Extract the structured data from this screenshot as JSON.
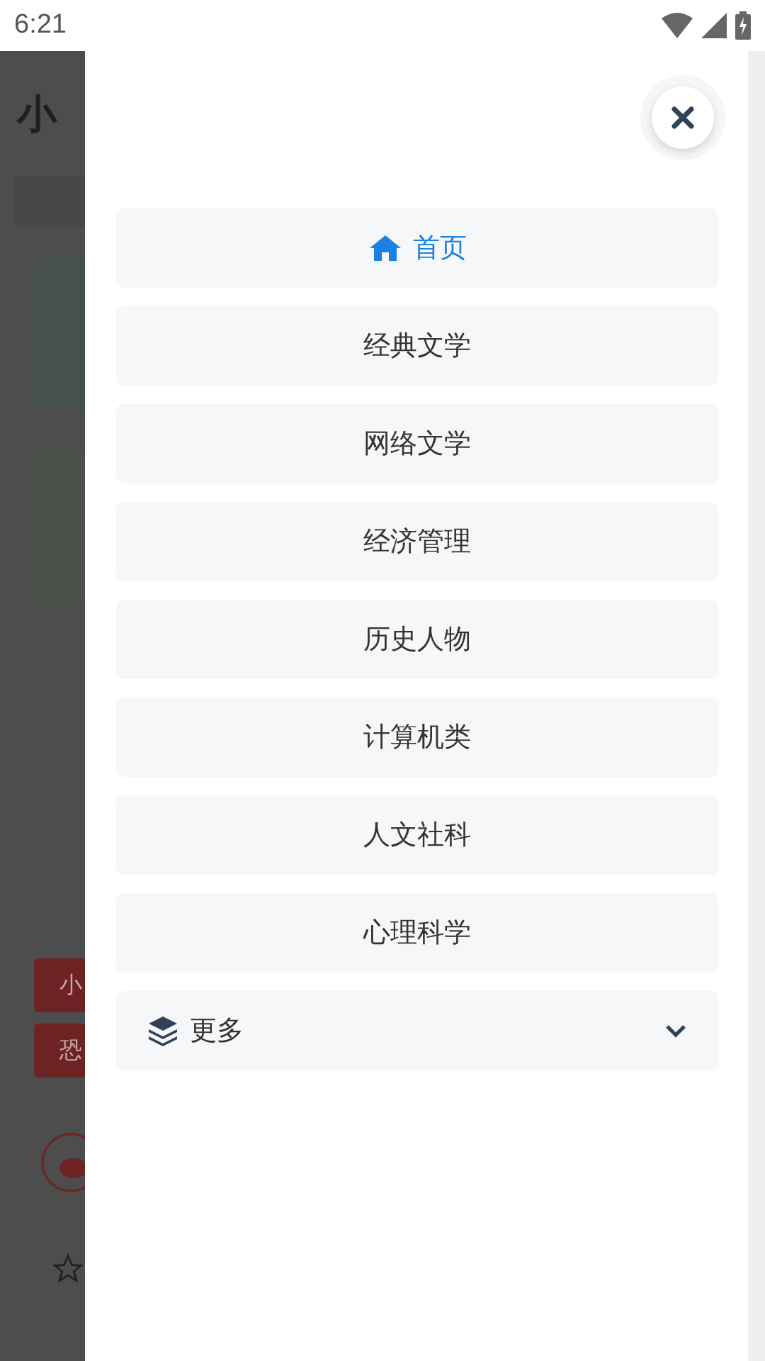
{
  "status_bar": {
    "time": "6:21"
  },
  "background_page": {
    "title": "小",
    "tags": [
      "小",
      "恐"
    ]
  },
  "menu": {
    "items": [
      {
        "label": "首页",
        "selected": true,
        "kind": "link"
      },
      {
        "label": "经典文学",
        "selected": false,
        "kind": "link"
      },
      {
        "label": "网络文学",
        "selected": false,
        "kind": "link"
      },
      {
        "label": "经济管理",
        "selected": false,
        "kind": "link"
      },
      {
        "label": "历史人物",
        "selected": false,
        "kind": "link"
      },
      {
        "label": "计算机类",
        "selected": false,
        "kind": "link"
      },
      {
        "label": "人文社科",
        "selected": false,
        "kind": "link"
      },
      {
        "label": "心理科学",
        "selected": false,
        "kind": "link"
      },
      {
        "label": "更多",
        "selected": false,
        "kind": "dropdown",
        "expanded": false
      }
    ]
  }
}
